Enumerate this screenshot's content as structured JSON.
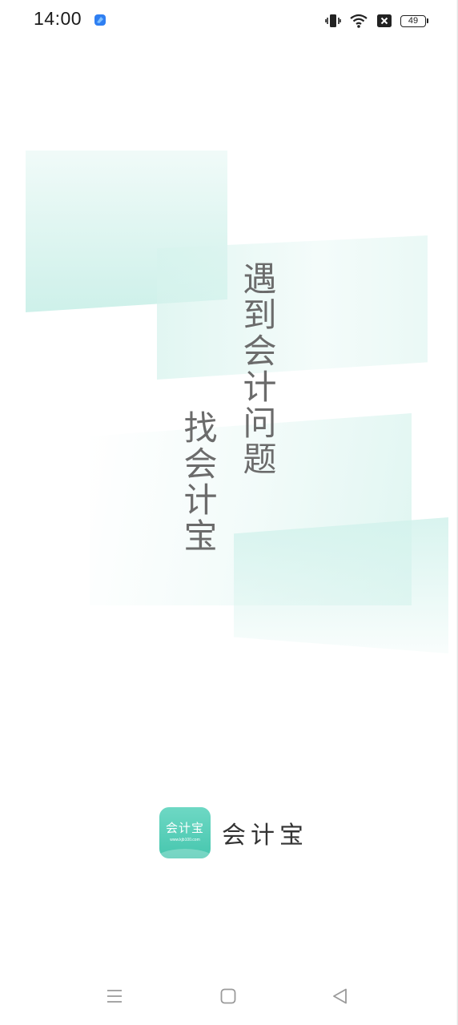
{
  "status_bar": {
    "time": "14:00",
    "battery_level": "49",
    "icons": [
      "app-notification-icon",
      "vibrate-icon",
      "wifi-icon",
      "no-sim-icon",
      "battery-icon"
    ]
  },
  "splash": {
    "slogan_line1": "遇到会计问题",
    "slogan_line2": "找会计宝"
  },
  "brand": {
    "icon_text": "会计宝",
    "icon_url": "www.kjb100.com",
    "name": "会计宝",
    "accent_color": "#4cc9b0"
  },
  "nav_bar": {
    "icons": [
      "menu-icon",
      "home-icon",
      "back-icon"
    ]
  }
}
